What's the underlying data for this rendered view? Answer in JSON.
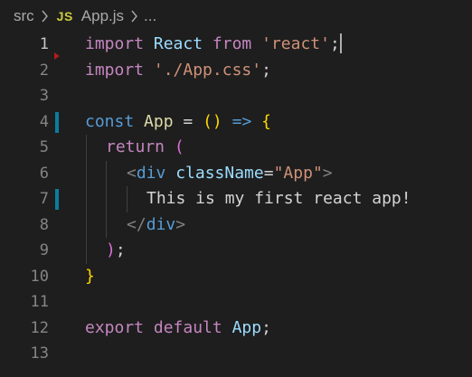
{
  "breadcrumb": {
    "folder": "src",
    "file_icon_label": "JS",
    "file": "App.js",
    "more": "..."
  },
  "editor": {
    "line_numbers": [
      "1",
      "2",
      "3",
      "4",
      "5",
      "6",
      "7",
      "8",
      "9",
      "10",
      "11",
      "12",
      "13"
    ],
    "lines": {
      "l1": {
        "import": "import",
        "react_id": "React",
        "from": "from",
        "module": "'react'",
        "semi": ";"
      },
      "l2": {
        "import": "import",
        "module": "'./App.css'",
        "semi": ";"
      },
      "l4": {
        "const": "const",
        "name": "App",
        "eq": "=",
        "paren": "()",
        "arrow": "=>",
        "brace": "{"
      },
      "l5": {
        "return": "return",
        "paren": "("
      },
      "l6": {
        "open": "<",
        "tag": "div",
        "attr": "className",
        "eq": "=",
        "value": "\"App\"",
        "close": ">"
      },
      "l7": {
        "text": "This is my first react app!"
      },
      "l8": {
        "open": "</",
        "tag": "div",
        "close": ">"
      },
      "l9": {
        "paren": ")",
        "semi": ";"
      },
      "l10": {
        "brace": "}"
      },
      "l12": {
        "export": "export",
        "default": "default",
        "name": "App",
        "semi": ";"
      }
    }
  },
  "colors": {
    "background": "#1e1e1e",
    "keyword_control": "#c586c0",
    "keyword": "#569cd6",
    "string": "#ce9178",
    "variable": "#9cdcfe",
    "bracket_level1": "#ffd700",
    "bracket_level2": "#da70d6",
    "modified_gutter": "#0c7d9d"
  }
}
